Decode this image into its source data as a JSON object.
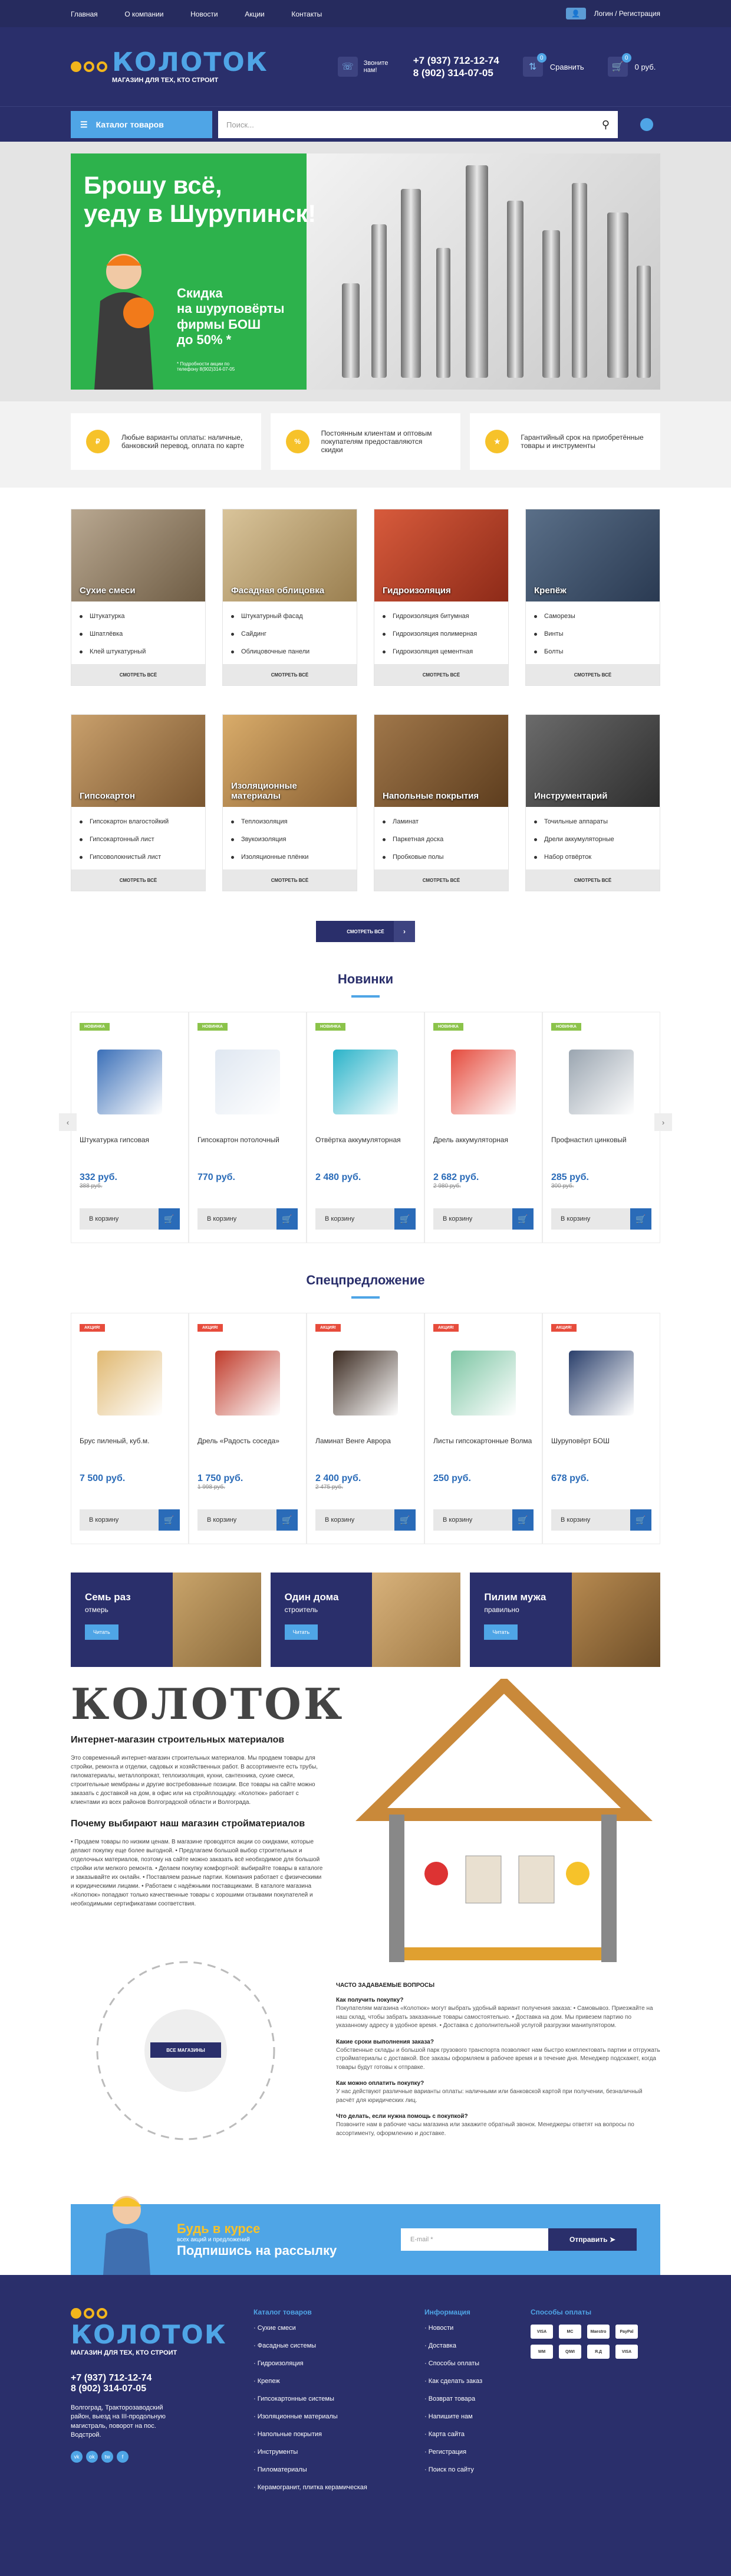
{
  "topbar": {
    "nav": [
      "Главная",
      "О компании",
      "Новости",
      "Акции",
      "Контакты"
    ],
    "login": "Логин",
    "register": "Регистрация"
  },
  "header": {
    "logo": "КОЛОТОК",
    "slogan": "МАГАЗИН ДЛЯ ТЕХ, КТО СТРОИТ",
    "call": "Звоните нам!",
    "phone1": "+7 (937) 712-12-74",
    "phone2": "8 (902) 314-07-05",
    "compare": "Сравнить",
    "compare_count": "0",
    "cart_count": "0",
    "cart_sum": "0 руб."
  },
  "search": {
    "catalog": "Каталог товаров",
    "placeholder": "Поиск..."
  },
  "banner": {
    "title1": "Брошу всё,",
    "title2": "уеду в Шурупинск!",
    "sub1": "Скидка",
    "sub2": "на шуруповёрты",
    "sub3": "фирмы БОШ",
    "sub4": "до 50% *",
    "small": "* Подробности акции по телефону 8(902)314-07-05"
  },
  "advantages": [
    "Любые варианты оплаты: наличные, банковский перевод, оплата по карте",
    "Постоянным клиентам и оптовым покупателям предоставляются скидки",
    "Гарантийный срок на приобретённые товары и инструменты"
  ],
  "categories": [
    {
      "name": "Сухие смеси",
      "items": [
        "Штукатурка",
        "Шпатлёвка",
        "Клей штукатурный"
      ],
      "all": "СМОТРЕТЬ ВСЁ"
    },
    {
      "name": "Фасадная облицовка",
      "items": [
        "Штукатурный фасад",
        "Сайдинг",
        "Облицовочные панели"
      ],
      "all": "СМОТРЕТЬ ВСЁ"
    },
    {
      "name": "Гидроизоляция",
      "items": [
        "Гидроизоляция битумная",
        "Гидроизоляция полимерная",
        "Гидроизоляция цементная"
      ],
      "all": "СМОТРЕТЬ ВСЁ"
    },
    {
      "name": "Крепёж",
      "items": [
        "Саморезы",
        "Винты",
        "Болты"
      ],
      "all": "СМОТРЕТЬ ВСЁ"
    },
    {
      "name": "Гипсокартон",
      "items": [
        "Гипсокартон влагостойкий",
        "Гипсокартонный лист",
        "Гипсоволокнистый лист"
      ],
      "all": "СМОТРЕТЬ ВСЁ"
    },
    {
      "name": "Изоляционные материалы",
      "items": [
        "Теплоизоляция",
        "Звукоизоляция",
        "Изоляционные плёнки"
      ],
      "all": "СМОТРЕТЬ ВСЁ"
    },
    {
      "name": "Напольные покрытия",
      "items": [
        "Ламинат",
        "Паркетная доска",
        "Пробковые полы"
      ],
      "all": "СМОТРЕТЬ ВСЁ"
    },
    {
      "name": "Инструментарий",
      "items": [
        "Точильные аппараты",
        "Дрели аккумуляторные",
        "Набор отвёрток"
      ],
      "all": "СМОТРЕТЬ ВСЁ"
    }
  ],
  "show_all": "СМОТРЕТЬ ВСЁ",
  "new_title": "Новинки",
  "new_products": [
    {
      "tag": "НОВИНКА",
      "name": "Штукатурка гипсовая",
      "price": "332 руб.",
      "old": "388 руб.",
      "cart": "В корзину"
    },
    {
      "tag": "НОВИНКА",
      "name": "Гипсокартон потолочный",
      "price": "770 руб.",
      "old": "",
      "cart": "В корзину"
    },
    {
      "tag": "НОВИНКА",
      "name": "Отвёртка аккумуляторная",
      "price": "2 480 руб.",
      "old": "",
      "cart": "В корзину"
    },
    {
      "tag": "НОВИНКА",
      "name": "Дрель аккумуляторная",
      "price": "2 682 руб.",
      "old": "2 980 руб.",
      "cart": "В корзину"
    },
    {
      "tag": "НОВИНКА",
      "name": "Профнастил цинковый",
      "price": "285 руб.",
      "old": "300 руб.",
      "cart": "В корзину"
    }
  ],
  "special_title": "Спецпредложение",
  "special_products": [
    {
      "tag": "АКЦИЯ!",
      "name": "Брус пиленый, куб.м.",
      "price": "7 500 руб.",
      "old": "",
      "cart": "В корзину"
    },
    {
      "tag": "АКЦИЯ!",
      "name": "Дрель «Радость соседа»",
      "price": "1 750 руб.",
      "old": "1 998 руб.",
      "cart": "В корзину"
    },
    {
      "tag": "АКЦИЯ!",
      "name": "Ламинат Венге Аврора",
      "price": "2 400 руб.",
      "old": "2 475 руб.",
      "cart": "В корзину"
    },
    {
      "tag": "АКЦИЯ!",
      "name": "Листы гипсокартонные Волма",
      "price": "250 руб.",
      "old": "",
      "cart": "В корзину"
    },
    {
      "tag": "АКЦИЯ!",
      "name": "Шуруповёрт БОШ",
      "price": "678 руб.",
      "old": "",
      "cart": "В корзину"
    }
  ],
  "promos": [
    {
      "title": "Семь раз",
      "sub": "отмерь",
      "btn": "Читать"
    },
    {
      "title": "Один дома",
      "sub": "строитель",
      "btn": "Читать"
    },
    {
      "title": "Пилим мужа",
      "sub": "правильно",
      "btn": "Читать"
    }
  ],
  "about": {
    "logo": "КОЛОТОК",
    "h1": "Интернет-магазин строительных материалов",
    "p1": "Это современный интернет-магазин строительных материалов. Мы продаем товары для стройки, ремонта и отделки, садовых и хозяйственных работ. В ассортименте есть трубы, пиломатериалы, металлопрокат, теплоизоляция, кухни, сантехника, сухие смеси, строительные мембраны и другие востребованные позиции. Все товары на сайте можно заказать с доставкой на дом, в офис или на стройплощадку. «Колотюк» работает с клиентами из всех районов Волгоградской области и Волгограда.",
    "h2": "Почему выбирают наш магазин стройматериалов",
    "p2": "• Продаем товары по низким ценам. В магазине проводятся акции со скидками, которые делают покупку еще более выгодной. • Предлагаем большой выбор строительных и отделочных материалов, поэтому на сайте можно заказать всё необходимое для большой стройки или мелкого ремонта. • Делаем покупку комфортной: выбирайте товары в каталоге и заказывайте их онлайн. • Поставляем разные партии. Компания работает с физическими и юридическими лицами. • Работаем с надёжными поставщиками. В каталоге магазина «Колотюк» попадают только качественные товары с хорошими отзывами покупателей и необходимыми сертификатами соответствия.",
    "wheel": "ВСЕ МАГАЗИНЫ"
  },
  "faq": {
    "title": "ЧАСТО ЗАДАВАЕМЫЕ ВОПРОСЫ",
    "q1": "Как получить покупку?",
    "a1": "Покупателям магазина «Колотюк» могут выбрать удобный вариант получения заказа: • Самовывоз. Приезжайте на наш склад, чтобы забрать заказанные товары самостоятельно. • Доставка на дом. Мы привезем партию по указанному адресу в удобное время. • Доставка с дополнительной услугой разгрузки манипулятором.",
    "q2": "Какие сроки выполнения заказа?",
    "a2": "Собственные склады и большой парк грузового транспорта позволяют нам быстро комплектовать партии и отгружать стройматериалы с доставкой. Все заказы оформляем в рабочее время и в течение дня. Менеджер подскажет, когда товары будут готовы к отправке.",
    "q3": "Как можно оплатить покупку?",
    "a3": "У нас действуют различные варианты оплаты: наличными или банковской картой при получении, безналичный расчёт для юридических лиц.",
    "q4": "Что делать, если нужна помощь с покупкой?",
    "a4": "Позвоните нам в рабочие часы магазина или закажите обратный звонок. Менеджеры ответят на вопросы по ассортименту, оформлению и доставке."
  },
  "subscribe": {
    "t1": "Будь в курсе",
    "t2": "всех акций и предложений",
    "t3": "Подпишись на рассылку",
    "placeholder": "E-mail *",
    "btn": "Отправить"
  },
  "footer": {
    "logo": "КОЛОТОК",
    "slogan": "МАГАЗИН ДЛЯ ТЕХ, КТО СТРОИТ",
    "phone1": "+7 (937) 712-12-74",
    "phone2": "8 (902) 314-07-05",
    "address": "Волгоград, Тракторозаводский район, выезд на III-продольную магистраль, поворот на пос. Водстрой.",
    "cat_title": "Каталог товаров",
    "cat": [
      "Сухие смеси",
      "Фасадные системы",
      "Гидроизоляция",
      "Крепеж",
      "Гипсокартонные системы",
      "Изоляционные материалы",
      "Напольные покрытия",
      "Инструменты",
      "Пиломатериалы",
      "Керамогранит, плитка керамическая"
    ],
    "info_title": "Информация",
    "info": [
      "Новости",
      "Доставка",
      "Способы оплаты",
      "Как сделать заказ",
      "Возврат товара",
      "Напишите нам",
      "Карта сайта",
      "Регистрация",
      "Поиск по сайту"
    ],
    "pay_title": "Способы оплаты",
    "pay": [
      "VISA",
      "MC",
      "Maestro",
      "PayPal",
      "WM",
      "QIWI",
      "Я.Д",
      "VISA"
    ]
  },
  "colors": {
    "navy": "#2a2f6b",
    "blue": "#4fa5e6",
    "yellow": "#f6c22a",
    "green": "#2db24c"
  }
}
